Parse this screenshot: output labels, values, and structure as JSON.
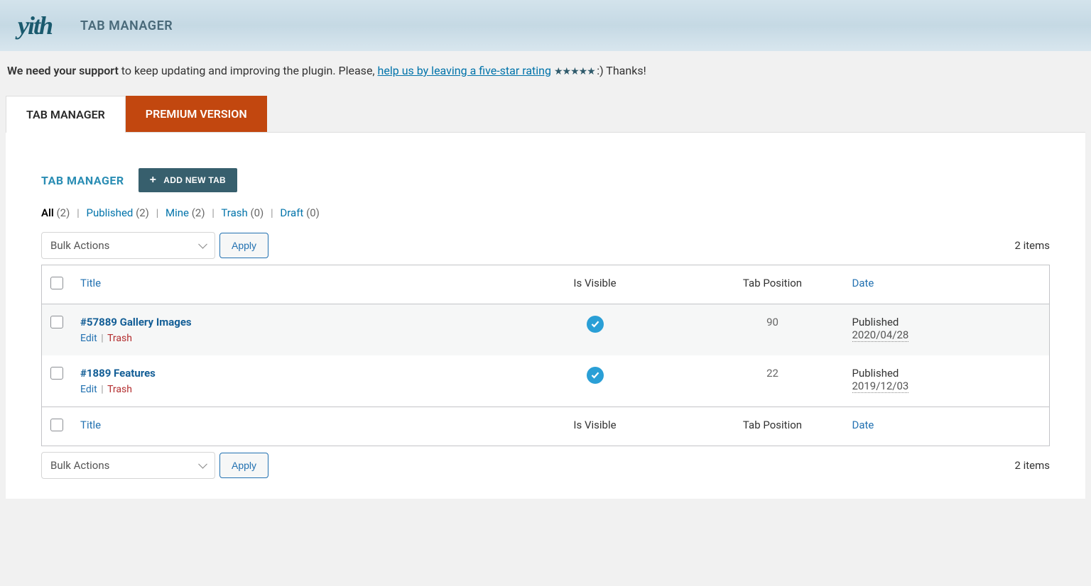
{
  "header": {
    "logo": "yith",
    "title": "TAB MANAGER"
  },
  "notice": {
    "bold": "We need your support",
    "text1": " to keep updating and improving the plugin. Please, ",
    "link": "help us by leaving a five-star rating",
    "text2": " :) Thanks!"
  },
  "tabs": {
    "manager": "TAB MANAGER",
    "premium": "PREMIUM VERSION"
  },
  "page": {
    "title": "TAB MANAGER",
    "add_button": "ADD NEW TAB"
  },
  "filters": [
    {
      "label": "All",
      "count": "(2)",
      "active": true
    },
    {
      "label": "Published",
      "count": "(2)",
      "active": false
    },
    {
      "label": "Mine",
      "count": "(2)",
      "active": false
    },
    {
      "label": "Trash",
      "count": "(0)",
      "active": false
    },
    {
      "label": "Draft",
      "count": "(0)",
      "active": false
    }
  ],
  "bulk": {
    "selected": "Bulk Actions",
    "apply": "Apply"
  },
  "count_label": "2 items",
  "columns": {
    "title": "Title",
    "visible": "Is Visible",
    "position": "Tab Position",
    "date": "Date"
  },
  "rows": [
    {
      "title": "#57889 Gallery Images",
      "edit": "Edit",
      "trash": "Trash",
      "position": "90",
      "status": "Published",
      "date": "2020/04/28"
    },
    {
      "title": "#1889 Features",
      "edit": "Edit",
      "trash": "Trash",
      "position": "22",
      "status": "Published",
      "date": "2019/12/03"
    }
  ]
}
